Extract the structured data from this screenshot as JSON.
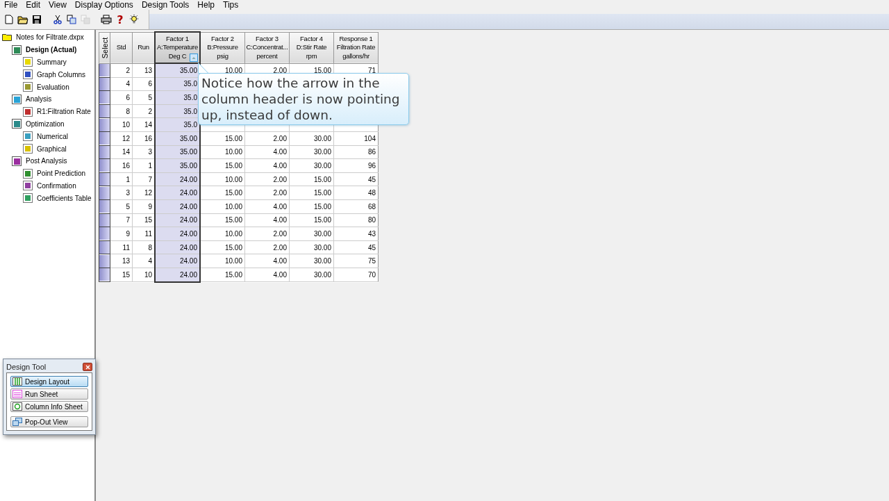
{
  "menu": [
    "File",
    "Edit",
    "View",
    "Display Options",
    "Design Tools",
    "Help",
    "Tips"
  ],
  "toolbar": [
    {
      "kind": "new",
      "disabled": false
    },
    {
      "kind": "open",
      "disabled": false
    },
    {
      "kind": "save",
      "disabled": false
    },
    {
      "kind": "cut",
      "disabled": false
    },
    {
      "kind": "copy",
      "disabled": false
    },
    {
      "kind": "paste",
      "disabled": true
    },
    {
      "kind": "print",
      "disabled": false
    },
    {
      "kind": "help",
      "label": "?",
      "disabled": false
    },
    {
      "kind": "tip",
      "disabled": false
    }
  ],
  "tree": {
    "label": "Notes for Filtrate.dxpx",
    "children": [
      {
        "label": "Design (Actual)",
        "selected": true,
        "children": [
          {
            "label": "Summary",
            "selected": false
          },
          {
            "label": "Graph Columns",
            "selected": false
          },
          {
            "label": "Evaluation",
            "selected": false
          }
        ]
      },
      {
        "label": "Analysis",
        "selected": false,
        "children": [
          {
            "label": "R1:Filtration Rate",
            "selected": false
          }
        ]
      },
      {
        "label": "Optimization",
        "selected": false,
        "children": [
          {
            "label": "Numerical",
            "selected": false
          },
          {
            "label": "Graphical",
            "selected": false
          }
        ]
      },
      {
        "label": "Post Analysis",
        "selected": false,
        "children": [
          {
            "label": "Point Prediction",
            "selected": false
          },
          {
            "label": "Confirmation",
            "selected": false
          },
          {
            "label": "Coefficients Table",
            "selected": false
          }
        ]
      }
    ]
  },
  "table": {
    "select_header": "Select",
    "columns": [
      {
        "lines": [
          "Std"
        ],
        "selected": false
      },
      {
        "lines": [
          "Run"
        ],
        "selected": false
      },
      {
        "lines": [
          "Factor 1",
          "A:Temperature",
          "Deg C"
        ],
        "selected": true,
        "sort_ascending": true
      },
      {
        "lines": [
          "Factor 2",
          "B:Pressure",
          "psig"
        ],
        "selected": false
      },
      {
        "lines": [
          "Factor 3",
          "C:Concentrat...",
          "percent"
        ],
        "selected": false
      },
      {
        "lines": [
          "Factor 4",
          "D:Stir Rate",
          "rpm"
        ],
        "selected": false
      },
      {
        "lines": [
          "Response 1",
          "Filtration Rate",
          "gallons/hr"
        ],
        "selected": false
      }
    ],
    "rows": [
      [
        "2",
        "13",
        "35.00",
        "10.00",
        "2.00",
        "15.00",
        "71"
      ],
      [
        "4",
        "6",
        "35.0",
        null,
        null,
        null,
        null
      ],
      [
        "6",
        "5",
        "35.0",
        null,
        null,
        null,
        null
      ],
      [
        "8",
        "2",
        "35.0",
        null,
        null,
        null,
        null
      ],
      [
        "10",
        "14",
        "35.0",
        null,
        null,
        null,
        null
      ],
      [
        "12",
        "16",
        "35.00",
        "15.00",
        "2.00",
        "30.00",
        "104"
      ],
      [
        "14",
        "3",
        "35.00",
        "10.00",
        "4.00",
        "30.00",
        "86"
      ],
      [
        "16",
        "1",
        "35.00",
        "15.00",
        "4.00",
        "30.00",
        "96"
      ],
      [
        "1",
        "7",
        "24.00",
        "10.00",
        "2.00",
        "15.00",
        "45"
      ],
      [
        "3",
        "12",
        "24.00",
        "15.00",
        "2.00",
        "15.00",
        "48"
      ],
      [
        "5",
        "9",
        "24.00",
        "10.00",
        "4.00",
        "15.00",
        "68"
      ],
      [
        "7",
        "15",
        "24.00",
        "15.00",
        "4.00",
        "15.00",
        "80"
      ],
      [
        "9",
        "11",
        "24.00",
        "10.00",
        "2.00",
        "30.00",
        "43"
      ],
      [
        "11",
        "8",
        "24.00",
        "15.00",
        "2.00",
        "30.00",
        "45"
      ],
      [
        "13",
        "4",
        "24.00",
        "10.00",
        "4.00",
        "30.00",
        "75"
      ],
      [
        "15",
        "10",
        "24.00",
        "15.00",
        "4.00",
        "30.00",
        "70"
      ]
    ]
  },
  "callout": "Notice how the arrow in the column header is now pointing up, instead of down.",
  "design_tool": {
    "title": "Design Tool",
    "buttons": [
      {
        "label": "Design Layout",
        "kind": "layout",
        "selected": true
      },
      {
        "label": "Run Sheet",
        "kind": "sheet",
        "selected": false
      },
      {
        "label": "Column Info Sheet",
        "kind": "info",
        "selected": false
      },
      {
        "label": "Pop-Out View",
        "kind": "popout",
        "selected": false
      }
    ]
  }
}
